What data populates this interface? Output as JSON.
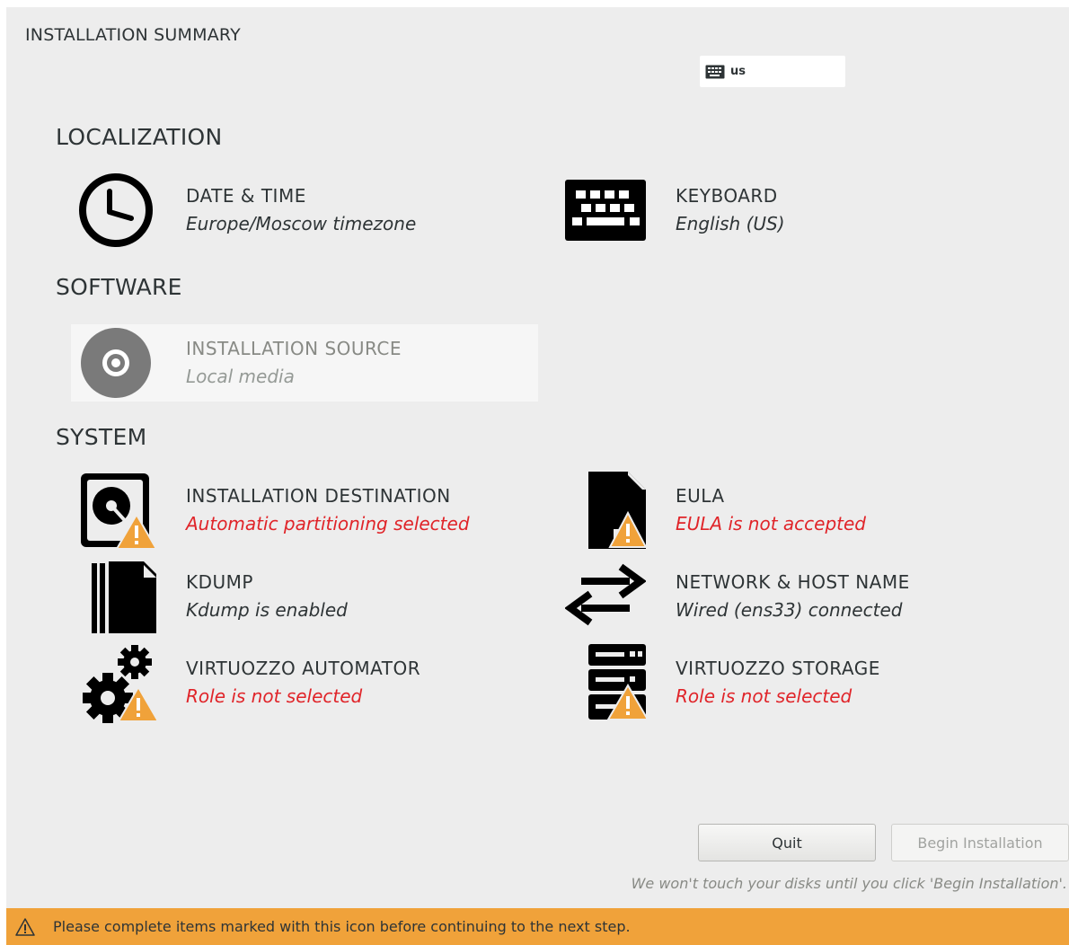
{
  "header": {
    "title": "INSTALLATION SUMMARY",
    "keyboard_layout": "us"
  },
  "sections": {
    "localization": "LOCALIZATION",
    "software": "SOFTWARE",
    "system": "SYSTEM"
  },
  "spokes": {
    "date_time": {
      "title": "DATE & TIME",
      "status": "Europe/Moscow timezone",
      "icon": "clock-icon"
    },
    "keyboard": {
      "title": "KEYBOARD",
      "status": "English (US)",
      "icon": "keyboard-icon"
    },
    "installation_source": {
      "title": "INSTALLATION SOURCE",
      "status": "Local media",
      "icon": "disc-icon"
    },
    "installation_destination": {
      "title": "INSTALLATION DESTINATION",
      "status": "Automatic partitioning selected",
      "icon": "harddisk-icon"
    },
    "eula": {
      "title": "EULA",
      "status": "EULA is not accepted",
      "icon": "document-icon"
    },
    "kdump": {
      "title": "KDUMP",
      "status": "Kdump is enabled",
      "icon": "kdump-icon"
    },
    "network": {
      "title": "NETWORK & HOST NAME",
      "status": "Wired (ens33) connected",
      "icon": "network-arrows-icon"
    },
    "virtuozzo_automator": {
      "title": "VIRTUOZZO AUTOMATOR",
      "status": "Role is not selected",
      "icon": "gears-icon"
    },
    "virtuozzo_storage": {
      "title": "VIRTUOZZO STORAGE",
      "status": "Role is not selected",
      "icon": "server-icon"
    }
  },
  "buttons": {
    "quit": "Quit",
    "begin": "Begin Installation"
  },
  "footer_note": "We won't touch your disks until you click 'Begin Installation'.",
  "warning_bar": {
    "text": "Please complete items marked with this icon before continuing to the next step."
  },
  "colors": {
    "warning": "#e02429",
    "warning_bar": "#f0a23a",
    "background": "#ededed"
  }
}
